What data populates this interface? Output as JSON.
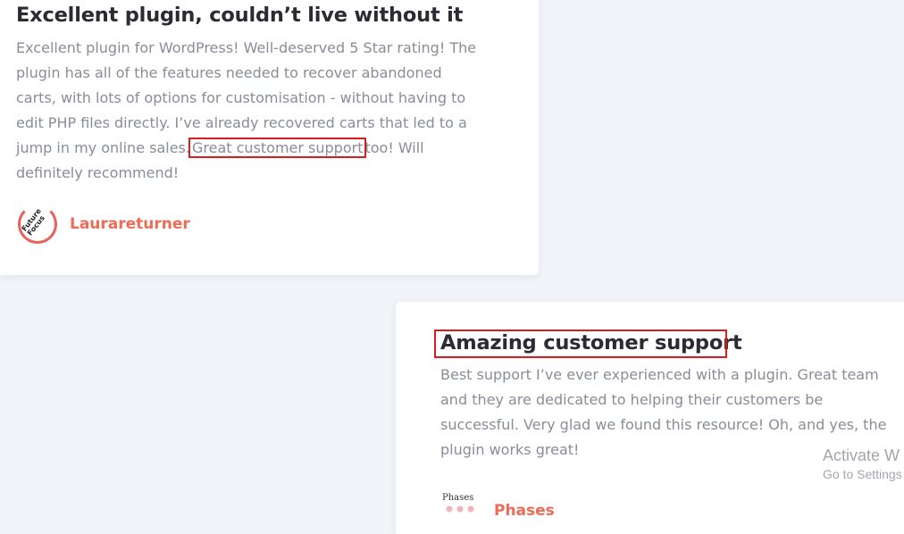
{
  "reviews": [
    {
      "title": "Excellent plugin, couldn’t live without it",
      "body_lines": [
        "Excellent plugin for WordPress! Well-deserved 5 Star rating! The",
        "plugin has all of the features needed to recover abandoned",
        "carts, with lots of options for customisation - without having to",
        "edit PHP files directly. I’ve already recovered carts that led to a"
      ],
      "line5_before": "jump in my online sales.",
      "line5_highlight": "Great customer support",
      "line5_after": "too! Will",
      "line6": "definitely recommend!",
      "author": "Laurareturner",
      "avatar_logo": "Future Focus"
    },
    {
      "title": "Amazing customer support",
      "body_lines": [
        "Best support I’ve ever experienced with a plugin. Great team",
        "and they are dedicated to helping their customers be",
        "successful. Very glad we found this resource! Oh, and yes, the",
        "plugin works great!"
      ],
      "author": "Phases",
      "avatar_logo": "Phases"
    }
  ],
  "highlight_color": "#d81d1d",
  "accent_color": "#ef6b56",
  "watermark": {
    "line1": "Activate W",
    "line2": "Go to Settings"
  }
}
